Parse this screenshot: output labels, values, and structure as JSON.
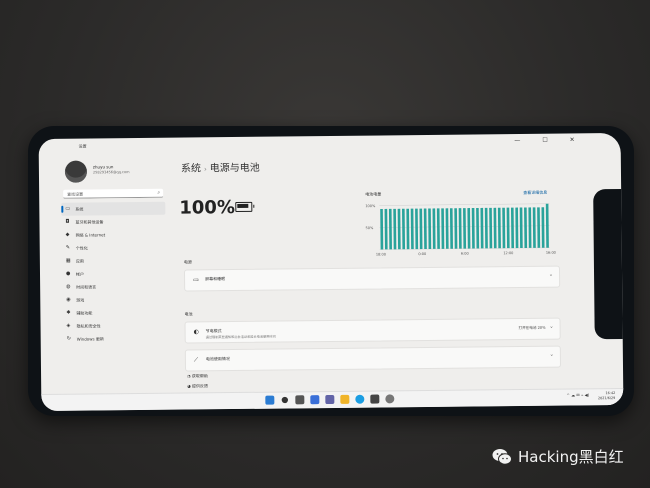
{
  "window": {
    "app_title": "设置",
    "controls": "— ☐ ✕"
  },
  "user": {
    "name": "zhuyu sun",
    "email": "258293456@qq.com"
  },
  "search": {
    "placeholder": "查找设置"
  },
  "nav": [
    {
      "label": "系统",
      "icon": "monitor-icon",
      "glyph": "▭",
      "active": true
    },
    {
      "label": "蓝牙和其他设备",
      "icon": "bluetooth-icon",
      "glyph": "◘"
    },
    {
      "label": "网络 & Internet",
      "icon": "wifi-icon",
      "glyph": "◆"
    },
    {
      "label": "个性化",
      "icon": "brush-icon",
      "glyph": "✎"
    },
    {
      "label": "应用",
      "icon": "apps-icon",
      "glyph": "▦"
    },
    {
      "label": "帐户",
      "icon": "account-icon",
      "glyph": "●"
    },
    {
      "label": "时间和语言",
      "icon": "globe-icon",
      "glyph": "◍"
    },
    {
      "label": "游戏",
      "icon": "game-icon",
      "glyph": "◉"
    },
    {
      "label": "辅助功能",
      "icon": "accessibility-icon",
      "glyph": "✱"
    },
    {
      "label": "隐私和安全性",
      "icon": "shield-icon",
      "glyph": "◈"
    },
    {
      "label": "Windows 更新",
      "icon": "update-icon",
      "glyph": "↻"
    }
  ],
  "breadcrumb": {
    "parent": "系统",
    "separator": "›",
    "current": "电源与电池"
  },
  "battery": {
    "percent": "100%",
    "level": 1.0
  },
  "chart_data": {
    "type": "bar",
    "title": "电池电量",
    "link": "查看详细信息",
    "y_ticks": [
      "100%",
      "50%"
    ],
    "x_ticks": [
      "18:00",
      "0:00",
      "6:00",
      "12:00",
      "16:00"
    ],
    "values": [
      92,
      92,
      92,
      92,
      92,
      92,
      92,
      92,
      92,
      92,
      92,
      92,
      92,
      92,
      92,
      92,
      92,
      92,
      92,
      92,
      92,
      92,
      92,
      92,
      92,
      92,
      92,
      92,
      92,
      92,
      92,
      92,
      92,
      92,
      92,
      92,
      92,
      92,
      100
    ],
    "ylim": [
      0,
      100
    ],
    "color": "#2aa39b"
  },
  "sections": {
    "display": {
      "label": "电源",
      "card_title": "屏幕和睡眠"
    },
    "battery": {
      "label": "电池",
      "saver_title": "节电模式",
      "saver_sub": "通过限制某些通知和后台活动来延长电池使用时间",
      "saver_value": "打开在电池 20%",
      "usage_title": "电池使用情况"
    }
  },
  "links": [
    "获取帮助",
    "提供反馈"
  ],
  "taskbar": {
    "tray": "^ ☁ ✉ ⌁ ◀)",
    "time": "16:42",
    "date": "2021/6/29"
  },
  "watermark": {
    "text": "Hacking黑白红"
  },
  "colors": {
    "accent": "#0067c0",
    "chart": "#2aa39b"
  }
}
